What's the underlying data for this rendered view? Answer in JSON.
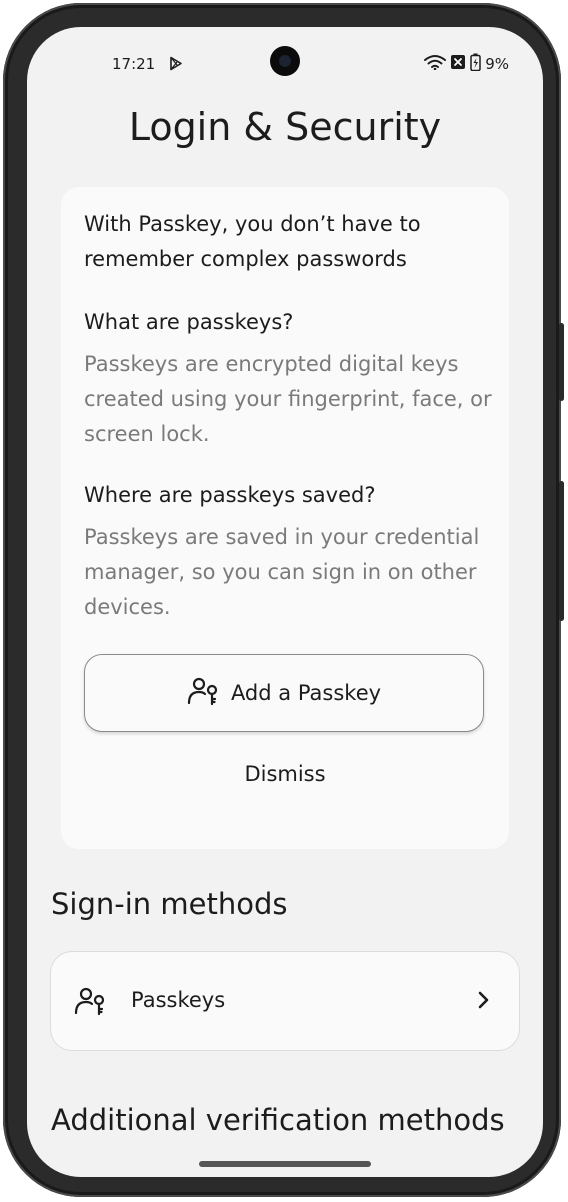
{
  "status_bar": {
    "time": "17:21",
    "battery": "9%",
    "icons": [
      "play-store-icon",
      "wifi-icon",
      "sim-error-icon",
      "battery-charging-icon"
    ]
  },
  "page": {
    "title": "Login & Security"
  },
  "passkey_card": {
    "intro": "With Passkey, you don’t have to remember complex passwords",
    "q1_title": "What are passkeys?",
    "q1_text": "Passkeys are encrypted digital keys created using your fingerprint, face, or screen lock.",
    "q2_title": "Where are passkeys saved?",
    "q2_text": "Passkeys are saved in your credential manager, so you can sign in on other devices.",
    "add_button_label": "Add a Passkey",
    "add_button_icon": "person-key-icon",
    "dismiss_label": "Dismiss"
  },
  "sign_in": {
    "section_title": "Sign-in methods",
    "items": [
      {
        "label": "Passkeys",
        "icon": "person-key-icon"
      }
    ]
  },
  "additional": {
    "section_title": "Additional verification methods"
  },
  "colors": {
    "background": "#f2f2f2",
    "card": "#fafafa",
    "text_primary": "#1c1c1c",
    "text_secondary": "#7a7a7a"
  }
}
